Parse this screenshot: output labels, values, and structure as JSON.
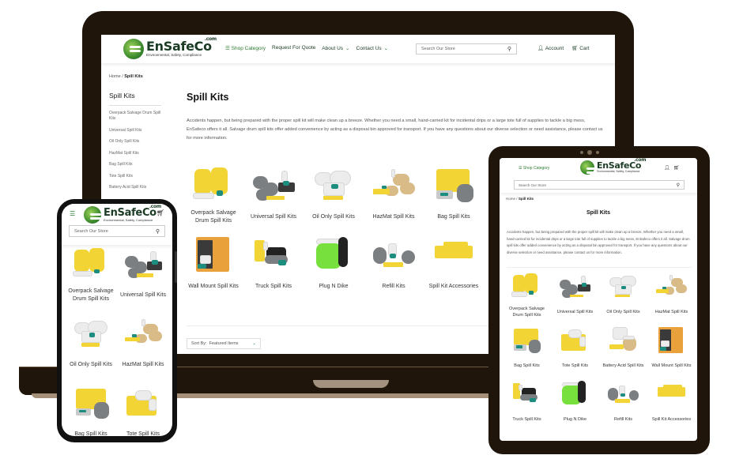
{
  "brand": {
    "name": "EnSafeCo",
    "tld": ".com",
    "tagline": "Environmental, Safety, Compliance",
    "colors": {
      "primary_green": "#2e7d32",
      "dark_text": "#1b3b24",
      "device_frame": "#1f150a"
    }
  },
  "laptop": {
    "nav": {
      "shop_category": "Shop Category",
      "request_quote": "Request For Quote",
      "about_us": "About Us",
      "contact_us": "Contact Us"
    },
    "search": {
      "placeholder": "Search Our Store"
    },
    "account_label": "Account",
    "cart_label": "Cart",
    "breadcrumb": {
      "home": "Home",
      "separator": "/",
      "current": "Spill Kits"
    },
    "sidebar": {
      "title": "Spill Kits",
      "items": [
        "Overpack Salvage Drum Spill Kits",
        "Universal Spill Kits",
        "Oil Only Spill Kits",
        "HazMat Spill Kits",
        "Bag Spill Kits",
        "Tote Spill Kits",
        "Battery Acid Spill Kits"
      ]
    },
    "page_title": "Spill Kits",
    "description": "Accidents happen, but being prepared with the proper spill kit will make clean up a breeze. Whether you need a small, hand-carried kit for incidental drips or a large tote full of supplies to tackle a big mess, EnSafeco offers it all. Salvage drum spill kits offer added convenience by acting as a disposal bin approved for transport. If you have any questions about our diverse selection or need assistance, please contact us for more information.",
    "categories": [
      {
        "label": "Overpack Salvage Drum Spill Kits",
        "icon": "salvage-drum"
      },
      {
        "label": "Universal Spill Kits",
        "icon": "universal"
      },
      {
        "label": "Oil Only Spill Kits",
        "icon": "oil-only"
      },
      {
        "label": "HazMat Spill Kits",
        "icon": "hazmat"
      },
      {
        "label": "Bag Spill Kits",
        "icon": "bag"
      },
      {
        "label": "Wall Mount Spill Kits",
        "icon": "wall-mount"
      },
      {
        "label": "Truck Spill Kits",
        "icon": "truck"
      },
      {
        "label": "Plug N Dike",
        "icon": "plug-n-dike"
      },
      {
        "label": "Refill Kits",
        "icon": "refill"
      },
      {
        "label": "Spill Kit Accessories",
        "icon": "accessories"
      }
    ],
    "sort": {
      "label": "Sort By:",
      "value": "Featured Items"
    }
  },
  "phone": {
    "search": {
      "placeholder": "Search Our Store"
    },
    "categories": [
      {
        "label": "Overpack Salvage Drum Spill Kits"
      },
      {
        "label": "Universal Spill Kits"
      },
      {
        "label": "Oil Only Spill Kits"
      },
      {
        "label": "HazMat Spill Kits"
      },
      {
        "label": "Bag Spill Kits"
      },
      {
        "label": "Tote Spill Kits"
      }
    ]
  },
  "tablet": {
    "shop_category": "Shop Category",
    "search": {
      "placeholder": "Search Our Store"
    },
    "breadcrumb": {
      "home": "Home",
      "separator": "/",
      "current": "Spill Kits"
    },
    "page_title": "Spill Kits",
    "description": "Accidents happen, but being prepared with the proper spill kit will make clean up a breeze. Whether you need a small, hand-carried kit for incidental drips or a large tote full of supplies to tackle a big mess, EnSafeco offers it all. Salvage drum spill kits offer added convenience by acting as a disposal bin approved for transport. If you have any questions about our diverse selection or need assistance, please contact us for more information.",
    "categories": [
      {
        "label": "Overpack Salvage Drum Spill Kits"
      },
      {
        "label": "Universal Spill Kits"
      },
      {
        "label": "Oil Only Spill Kits"
      },
      {
        "label": "HazMat Spill Kits"
      },
      {
        "label": "Bag Spill Kits"
      },
      {
        "label": "Tote Spill Kits"
      },
      {
        "label": "Battery Acid Spill Kits"
      },
      {
        "label": "Wall Mount Spill Kits"
      },
      {
        "label": "Truck Spill Kits"
      },
      {
        "label": "Plug N Dike"
      },
      {
        "label": "Refill Kits"
      },
      {
        "label": "Spill Kit Accessories"
      }
    ]
  }
}
